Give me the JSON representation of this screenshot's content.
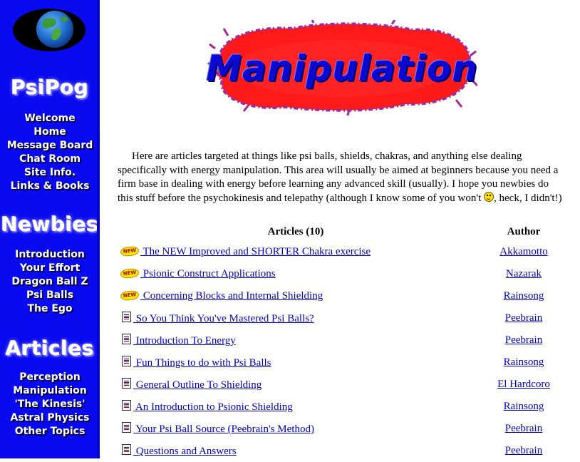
{
  "sidebar": {
    "sections": [
      {
        "title": "PsiPog",
        "items": [
          "Welcome",
          "Home",
          "Message Board",
          "Chat Room",
          "Site Info.",
          "Links & Books"
        ]
      },
      {
        "title": "Newbies",
        "items": [
          "Introduction",
          "Your Effort",
          "Dragon Ball Z",
          "Psi Balls",
          "The Ego"
        ]
      },
      {
        "title": "Articles",
        "items": [
          "Perception",
          "Manipulation",
          "'The Kinesis'",
          "Astral Physics",
          "Other Topics"
        ]
      }
    ]
  },
  "banner": {
    "title": "Manipulation",
    "accent": "#ff1a1a",
    "text_color": "#0a0ad0"
  },
  "intro": {
    "before_smiley": "Here are articles targeted at things like psi balls, shields, chakras, and anything else dealing specifically with energy manipulation. This area will usually be aimed at beginners because you need a firm base in dealing with energy before learning any advanced skill (usually). I hope you newbies do this stuff before the psychokinesis and telepathy (although I know some of you won't ",
    "after_smiley": ", heck, I didn't!)"
  },
  "table": {
    "header_articles": "Articles (10)",
    "header_author": "Author",
    "rows": [
      {
        "icon": "new-badge-icon",
        "badge": "NEW",
        "title": "The NEW Improved and SHORTER Chakra exercise",
        "author": "Akkamotto"
      },
      {
        "icon": "new-badge-icon",
        "badge": "NEW",
        "title": "Psionic Construct Applications",
        "author": "Nazarak"
      },
      {
        "icon": "new-badge-icon",
        "badge": "NEW",
        "title": "Concerning Blocks and Internal Shielding",
        "author": "Rainsong"
      },
      {
        "icon": "document-icon",
        "badge": "",
        "title": "So You Think You've Mastered Psi Balls?",
        "author": "Peebrain"
      },
      {
        "icon": "document-icon",
        "badge": "",
        "title": "Introduction To Energy",
        "author": "Peebrain"
      },
      {
        "icon": "document-icon",
        "badge": "",
        "title": "Fun Things to do with Psi Balls",
        "author": "Rainsong"
      },
      {
        "icon": "document-icon",
        "badge": "",
        "title": "General Outline To Shielding",
        "author": "El Hardcoro"
      },
      {
        "icon": "document-icon",
        "badge": "",
        "title": "An Introduction to Psionic Shielding",
        "author": "Rainsong"
      },
      {
        "icon": "document-icon",
        "badge": "",
        "title": "Your Psi Ball Source (Peebrain's Method)",
        "author": "Peebrain"
      },
      {
        "icon": "document-icon",
        "badge": "",
        "title": "Questions and Answers",
        "author": "Peebrain"
      }
    ]
  },
  "colors": {
    "sidebar_bg": "#0a0af0",
    "link": "#0000cc"
  }
}
